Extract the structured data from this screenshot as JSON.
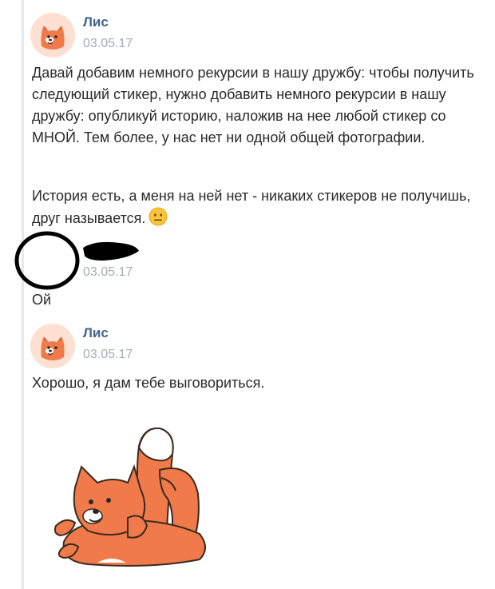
{
  "messages": [
    {
      "author": "Лис",
      "date": "03.05.17",
      "paragraphs": [
        "Давай добавим немного рекурсии в нашу дружбу: чтобы получить следующий стикер, нужно добавить немного рекурсии в нашу дружбу: опубликуй историю, наложив на нее любой стикер со МНОЙ. Тем более, у нас нет ни одной общей фотографии.",
        "История есть, а меня на ней нет - никаких стикеров не получишь, друг называется."
      ],
      "emoji": "neutral-face-emoji"
    },
    {
      "author": "",
      "date": "03.05.17",
      "text": "Ой"
    },
    {
      "author": "Лис",
      "date": "03.05.17",
      "text": "Хорошо, я дам тебе выговориться.",
      "sticker": "fox-lying-sticker"
    }
  ],
  "colors": {
    "author": "#43648c",
    "date": "#a5acb5",
    "text": "#2a2a2a",
    "fox": "#f07a4a",
    "avatar_bg": "#fde0d2"
  }
}
